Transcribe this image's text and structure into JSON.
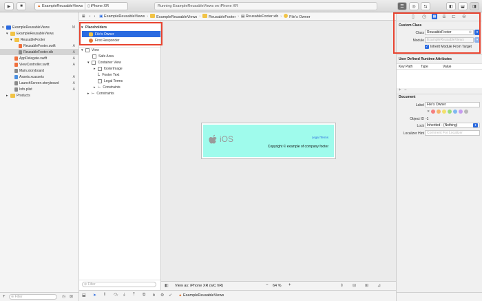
{
  "toolbar": {
    "scheme": "ExampleReusableViews",
    "device": "iPhone XR",
    "status": "Running ExampleReusableViews on iPhone XR"
  },
  "jumpbar": {
    "crumbs": [
      "ExampleReusableViews",
      "ExampleReusableViews",
      "ReusableFooter",
      "ReusableFooter.xib",
      "File's Owner"
    ]
  },
  "navigator": {
    "items": [
      {
        "label": "ExampleReusableViews",
        "badge": "M"
      },
      {
        "label": "ExampleReusableViews",
        "badge": ""
      },
      {
        "label": "ReusableFooter",
        "badge": ""
      },
      {
        "label": "ReusableFooter.swift",
        "badge": "A"
      },
      {
        "label": "ReusableFooter.xib",
        "badge": "A"
      },
      {
        "label": "AppDelegate.swift",
        "badge": "A"
      },
      {
        "label": "ViewController.swift",
        "badge": "A"
      },
      {
        "label": "Main.storyboard",
        "badge": ""
      },
      {
        "label": "Assets.xcassets",
        "badge": "A"
      },
      {
        "label": "LaunchScreen.storyboard",
        "badge": "A"
      },
      {
        "label": "Info.plist",
        "badge": "A"
      },
      {
        "label": "Products",
        "badge": ""
      }
    ],
    "filter_placeholder": "Filter"
  },
  "outline": {
    "placeholders_header": "Placeholders",
    "files_owner": "File's Owner",
    "first_responder": "First Responder",
    "view": "View",
    "safe_area": "Safe Area",
    "container_view": "Container View",
    "footer_image": "footerImage",
    "footer_text": "Footer Text",
    "legal_terms": "Legal Terms",
    "constraints_inner": "Constraints",
    "constraints": "Constraints",
    "filter_placeholder": "Filter"
  },
  "canvas": {
    "ios_text": "iOS",
    "legal_link": "Legal Terms",
    "copyright": "Copyright © example of company footer",
    "view_as": "View as: iPhone XR (wC hR)",
    "zoom": "64 %"
  },
  "inspector": {
    "custom_class_title": "Custom Class",
    "class_label": "Class",
    "class_value": "ReusableFooter",
    "module_label": "Module",
    "module_placeholder": "ExampleReusableViews",
    "inherit_label": "Inherit Module From Target",
    "udra_title": "User Defined Runtime Attributes",
    "col_keypath": "Key Path",
    "col_type": "Type",
    "col_value": "Value",
    "document_title": "Document",
    "label_label": "Label",
    "label_value": "File's Owner",
    "objectid_label": "Object ID",
    "objectid_value": "-1",
    "lock_label": "Lock",
    "lock_value": "Inherited - (Nothing)",
    "localizer_label": "Localizer Hint",
    "localizer_placeholder": "Comment For Localizer"
  },
  "colors": {
    "accent": "#2a6ae0",
    "highlight": "#e8432f",
    "footer_bg": "#9ffbec"
  },
  "bottom": {
    "breadcrumb": "ExampleReusableViews"
  }
}
